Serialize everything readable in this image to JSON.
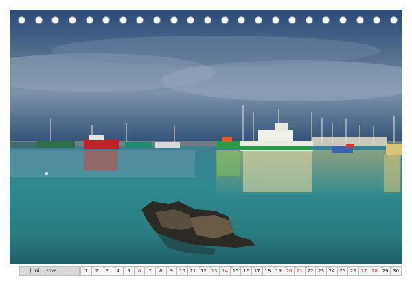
{
  "calendar": {
    "month": "Juni",
    "year": "2026",
    "days": [
      {
        "n": "1",
        "red": false,
        "wd": "Mo"
      },
      {
        "n": "2",
        "red": false,
        "wd": "Di"
      },
      {
        "n": "3",
        "red": false,
        "wd": "Mi"
      },
      {
        "n": "4",
        "red": false,
        "wd": "Do"
      },
      {
        "n": "5",
        "red": false,
        "wd": "Fr"
      },
      {
        "n": "6",
        "red": true,
        "wd": "Sa"
      },
      {
        "n": "7",
        "red": true,
        "wd": "So"
      },
      {
        "n": "8",
        "red": false,
        "wd": "Mo"
      },
      {
        "n": "9",
        "red": false,
        "wd": "Di"
      },
      {
        "n": "10",
        "red": false,
        "wd": "Mi"
      },
      {
        "n": "11",
        "red": false,
        "wd": "Do"
      },
      {
        "n": "12",
        "red": false,
        "wd": "Fr"
      },
      {
        "n": "13",
        "red": true,
        "wd": "Sa"
      },
      {
        "n": "14",
        "red": true,
        "wd": "So"
      },
      {
        "n": "15",
        "red": false,
        "wd": "Mo"
      },
      {
        "n": "16",
        "red": false,
        "wd": "Di"
      },
      {
        "n": "17",
        "red": false,
        "wd": "Mi"
      },
      {
        "n": "18",
        "red": false,
        "wd": "Do"
      },
      {
        "n": "19",
        "red": false,
        "wd": "Fr"
      },
      {
        "n": "20",
        "red": true,
        "wd": "Sa"
      },
      {
        "n": "21",
        "red": true,
        "wd": "So"
      },
      {
        "n": "22",
        "red": false,
        "wd": "Mo"
      },
      {
        "n": "23",
        "red": false,
        "wd": "Di"
      },
      {
        "n": "24",
        "red": false,
        "wd": "Mi"
      },
      {
        "n": "25",
        "red": false,
        "wd": "Do"
      },
      {
        "n": "26",
        "red": false,
        "wd": "Fr"
      },
      {
        "n": "27",
        "red": true,
        "wd": "Sa"
      },
      {
        "n": "28",
        "red": true,
        "wd": "So"
      },
      {
        "n": "29",
        "red": false,
        "wd": "Mo"
      },
      {
        "n": "30",
        "red": false,
        "wd": "Di"
      }
    ]
  },
  "binding": {
    "hole_count": 23
  },
  "colors": {
    "weekend": "#d2232a",
    "sky_top": "#2c4a78",
    "sky_mid": "#5f7b9c",
    "water": "#2f8c92",
    "boat_red": "#c0212a",
    "boat_green": "#2a9a48"
  },
  "photo": {
    "subject": "harbor-with-fishing-boats-and-rocks"
  }
}
